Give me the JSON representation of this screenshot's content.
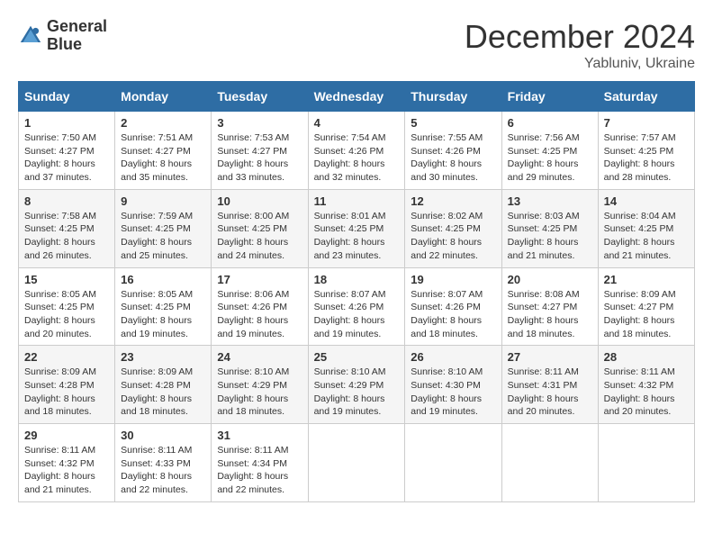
{
  "header": {
    "logo_line1": "General",
    "logo_line2": "Blue",
    "month_title": "December 2024",
    "location": "Yabluniv, Ukraine"
  },
  "weekdays": [
    "Sunday",
    "Monday",
    "Tuesday",
    "Wednesday",
    "Thursday",
    "Friday",
    "Saturday"
  ],
  "weeks": [
    [
      {
        "day": "1",
        "sunrise": "7:50 AM",
        "sunset": "4:27 PM",
        "daylight": "8 hours and 37 minutes."
      },
      {
        "day": "2",
        "sunrise": "7:51 AM",
        "sunset": "4:27 PM",
        "daylight": "8 hours and 35 minutes."
      },
      {
        "day": "3",
        "sunrise": "7:53 AM",
        "sunset": "4:27 PM",
        "daylight": "8 hours and 33 minutes."
      },
      {
        "day": "4",
        "sunrise": "7:54 AM",
        "sunset": "4:26 PM",
        "daylight": "8 hours and 32 minutes."
      },
      {
        "day": "5",
        "sunrise": "7:55 AM",
        "sunset": "4:26 PM",
        "daylight": "8 hours and 30 minutes."
      },
      {
        "day": "6",
        "sunrise": "7:56 AM",
        "sunset": "4:25 PM",
        "daylight": "8 hours and 29 minutes."
      },
      {
        "day": "7",
        "sunrise": "7:57 AM",
        "sunset": "4:25 PM",
        "daylight": "8 hours and 28 minutes."
      }
    ],
    [
      {
        "day": "8",
        "sunrise": "7:58 AM",
        "sunset": "4:25 PM",
        "daylight": "8 hours and 26 minutes."
      },
      {
        "day": "9",
        "sunrise": "7:59 AM",
        "sunset": "4:25 PM",
        "daylight": "8 hours and 25 minutes."
      },
      {
        "day": "10",
        "sunrise": "8:00 AM",
        "sunset": "4:25 PM",
        "daylight": "8 hours and 24 minutes."
      },
      {
        "day": "11",
        "sunrise": "8:01 AM",
        "sunset": "4:25 PM",
        "daylight": "8 hours and 23 minutes."
      },
      {
        "day": "12",
        "sunrise": "8:02 AM",
        "sunset": "4:25 PM",
        "daylight": "8 hours and 22 minutes."
      },
      {
        "day": "13",
        "sunrise": "8:03 AM",
        "sunset": "4:25 PM",
        "daylight": "8 hours and 21 minutes."
      },
      {
        "day": "14",
        "sunrise": "8:04 AM",
        "sunset": "4:25 PM",
        "daylight": "8 hours and 21 minutes."
      }
    ],
    [
      {
        "day": "15",
        "sunrise": "8:05 AM",
        "sunset": "4:25 PM",
        "daylight": "8 hours and 20 minutes."
      },
      {
        "day": "16",
        "sunrise": "8:05 AM",
        "sunset": "4:25 PM",
        "daylight": "8 hours and 19 minutes."
      },
      {
        "day": "17",
        "sunrise": "8:06 AM",
        "sunset": "4:26 PM",
        "daylight": "8 hours and 19 minutes."
      },
      {
        "day": "18",
        "sunrise": "8:07 AM",
        "sunset": "4:26 PM",
        "daylight": "8 hours and 19 minutes."
      },
      {
        "day": "19",
        "sunrise": "8:07 AM",
        "sunset": "4:26 PM",
        "daylight": "8 hours and 18 minutes."
      },
      {
        "day": "20",
        "sunrise": "8:08 AM",
        "sunset": "4:27 PM",
        "daylight": "8 hours and 18 minutes."
      },
      {
        "day": "21",
        "sunrise": "8:09 AM",
        "sunset": "4:27 PM",
        "daylight": "8 hours and 18 minutes."
      }
    ],
    [
      {
        "day": "22",
        "sunrise": "8:09 AM",
        "sunset": "4:28 PM",
        "daylight": "8 hours and 18 minutes."
      },
      {
        "day": "23",
        "sunrise": "8:09 AM",
        "sunset": "4:28 PM",
        "daylight": "8 hours and 18 minutes."
      },
      {
        "day": "24",
        "sunrise": "8:10 AM",
        "sunset": "4:29 PM",
        "daylight": "8 hours and 18 minutes."
      },
      {
        "day": "25",
        "sunrise": "8:10 AM",
        "sunset": "4:29 PM",
        "daylight": "8 hours and 19 minutes."
      },
      {
        "day": "26",
        "sunrise": "8:10 AM",
        "sunset": "4:30 PM",
        "daylight": "8 hours and 19 minutes."
      },
      {
        "day": "27",
        "sunrise": "8:11 AM",
        "sunset": "4:31 PM",
        "daylight": "8 hours and 20 minutes."
      },
      {
        "day": "28",
        "sunrise": "8:11 AM",
        "sunset": "4:32 PM",
        "daylight": "8 hours and 20 minutes."
      }
    ],
    [
      {
        "day": "29",
        "sunrise": "8:11 AM",
        "sunset": "4:32 PM",
        "daylight": "8 hours and 21 minutes."
      },
      {
        "day": "30",
        "sunrise": "8:11 AM",
        "sunset": "4:33 PM",
        "daylight": "8 hours and 22 minutes."
      },
      {
        "day": "31",
        "sunrise": "8:11 AM",
        "sunset": "4:34 PM",
        "daylight": "8 hours and 22 minutes."
      },
      null,
      null,
      null,
      null
    ]
  ]
}
